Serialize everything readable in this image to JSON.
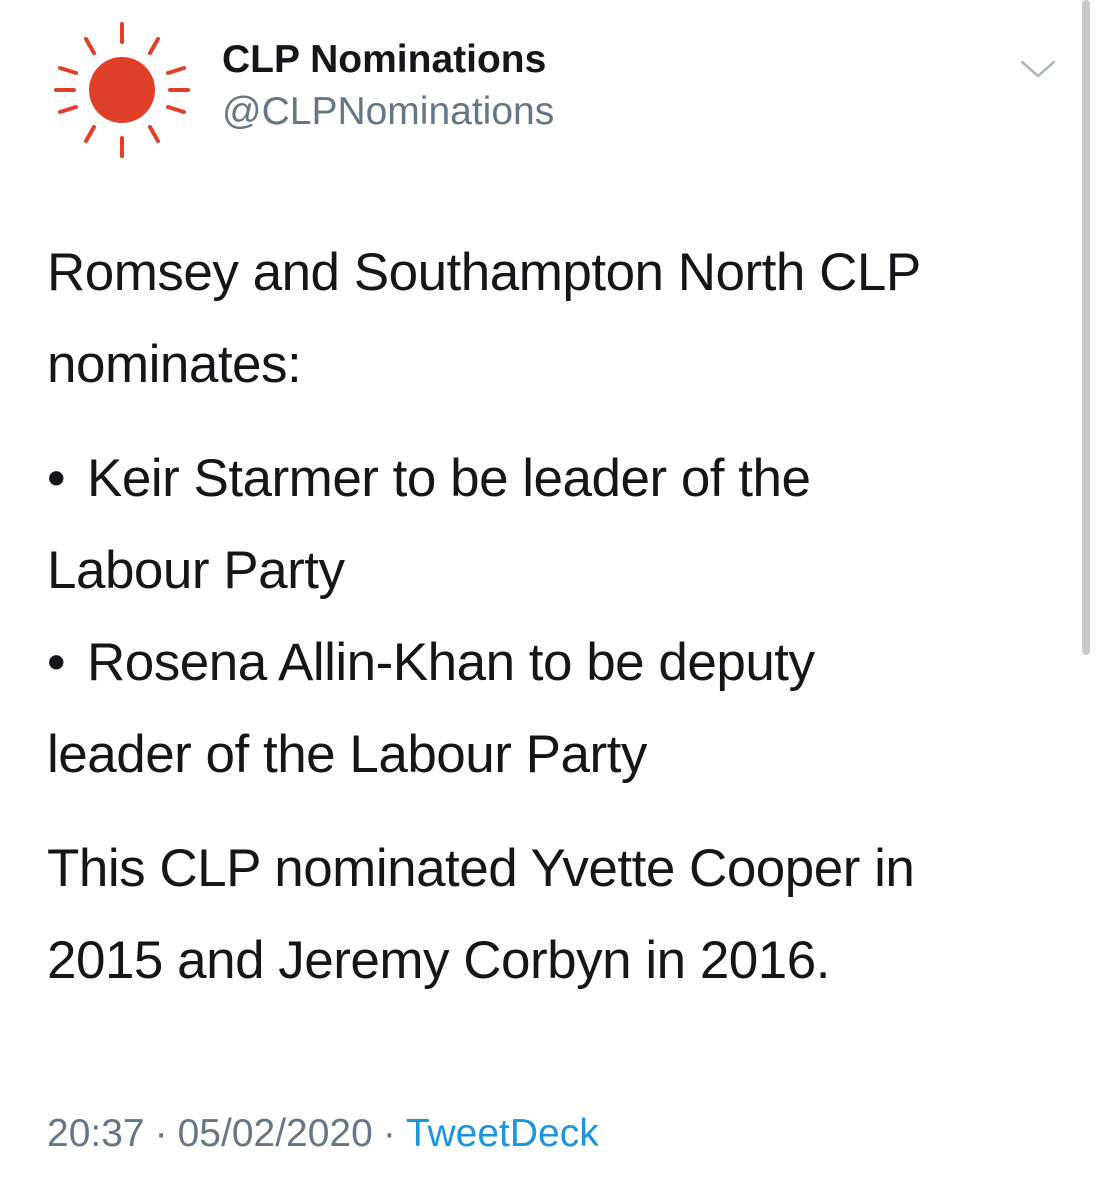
{
  "author": {
    "name": "CLP Nominations",
    "handle": "@CLPNominations",
    "avatar_icon": "sun-icon",
    "avatar_color": "#e0402a"
  },
  "menu": {
    "icon": "chevron-down-icon"
  },
  "tweet": {
    "lines": [
      "Romsey and Southampton North CLP",
      "nominates:",
      "Keir Starmer to be leader of the",
      "Labour Party",
      "Rosena Allin-Khan to be deputy",
      "leader of the Labour Party",
      "This CLP nominated Yvette Cooper in",
      "2015 and Jeremy Corbyn in 2016."
    ],
    "bullet": "•"
  },
  "meta": {
    "time": "20:37",
    "date": "05/02/2020",
    "separator": "·",
    "source": "TweetDeck",
    "source_color": "#1b95e0"
  }
}
